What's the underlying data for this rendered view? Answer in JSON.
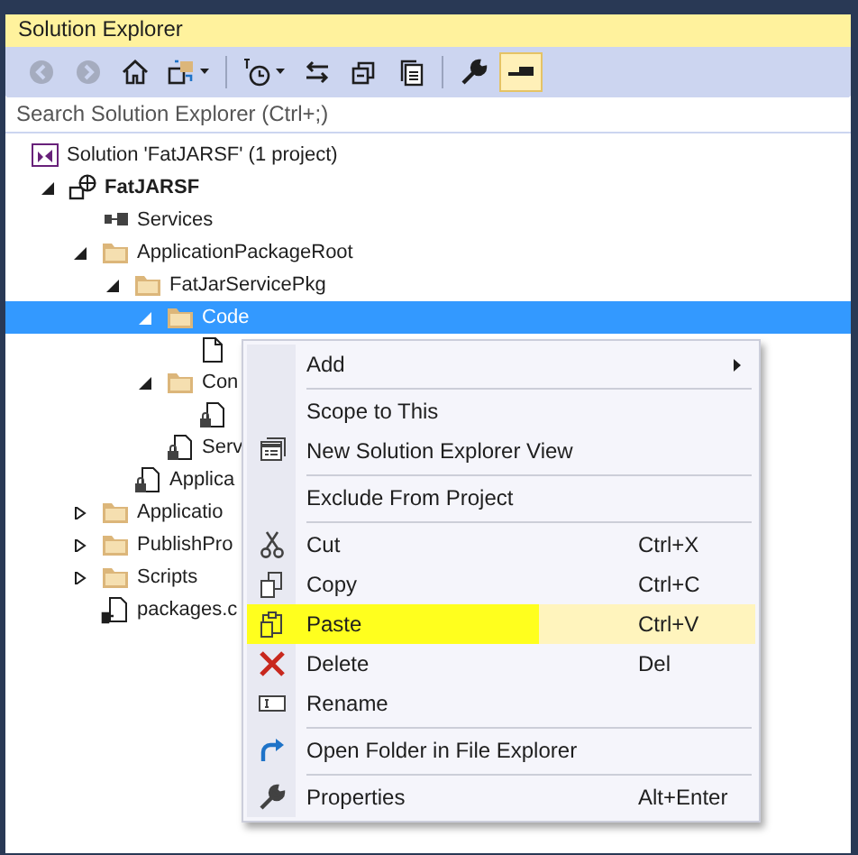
{
  "window": {
    "title": "Solution Explorer"
  },
  "toolbar": [
    {
      "kind": "back",
      "disabled": true,
      "pressed": false,
      "dropdown": false
    },
    {
      "kind": "forward",
      "disabled": true,
      "pressed": false,
      "dropdown": false
    },
    {
      "kind": "home",
      "disabled": false,
      "pressed": false,
      "dropdown": false
    },
    {
      "kind": "switch-views",
      "disabled": false,
      "pressed": false,
      "dropdown": true
    },
    {
      "kind": "separator"
    },
    {
      "kind": "pending-changes",
      "disabled": false,
      "pressed": false,
      "dropdown": true
    },
    {
      "kind": "sync",
      "disabled": false,
      "pressed": false,
      "dropdown": false
    },
    {
      "kind": "collapse",
      "disabled": false,
      "pressed": false,
      "dropdown": false
    },
    {
      "kind": "show-all",
      "disabled": false,
      "pressed": false,
      "dropdown": false
    },
    {
      "kind": "separator"
    },
    {
      "kind": "properties",
      "disabled": false,
      "pressed": false,
      "dropdown": false
    },
    {
      "kind": "preview",
      "disabled": false,
      "pressed": true,
      "dropdown": false
    }
  ],
  "search": {
    "placeholder": "Search Solution Explorer (Ctrl+;)"
  },
  "tree": [
    {
      "label": "Solution 'FatJARSF' (1 project)",
      "kind": "solution",
      "selected": false,
      "children": [
        {
          "label": "FatJARSF",
          "kind": "project",
          "expanded": true,
          "selected": false,
          "children": [
            {
              "label": "Services",
              "kind": "services",
              "selected": false
            },
            {
              "label": "ApplicationPackageRoot",
              "kind": "folder",
              "expanded": true,
              "selected": false,
              "children": [
                {
                  "label": "FatJarServicePkg",
                  "kind": "folder",
                  "expanded": true,
                  "selected": false,
                  "children": [
                    {
                      "label": "Code",
                      "kind": "folder",
                      "expanded": true,
                      "selected": true,
                      "children": [
                        {
                          "kind": "file",
                          "selected": false
                        }
                      ]
                    },
                    {
                      "label": "Con",
                      "kind": "folder",
                      "expanded": true,
                      "selected": false,
                      "children": [
                        {
                          "kind": "manifest",
                          "selected": false
                        }
                      ]
                    },
                    {
                      "label": "Serv",
                      "kind": "manifest",
                      "selected": false
                    }
                  ]
                },
                {
                  "label": "Applica",
                  "kind": "manifest",
                  "selected": false
                }
              ]
            },
            {
              "label": "Applicatio",
              "kind": "folder",
              "expanded": false,
              "selected": false
            },
            {
              "label": "PublishPro",
              "kind": "folder",
              "expanded": false,
              "selected": false
            },
            {
              "label": "Scripts",
              "kind": "folder",
              "expanded": false,
              "selected": false
            },
            {
              "label": "packages.c",
              "kind": "config",
              "selected": false
            }
          ]
        }
      ]
    }
  ],
  "context_menu": {
    "items": [
      {
        "kind": "add",
        "label": "Add",
        "submenu": true,
        "selected": false,
        "highlighted": false
      },
      {
        "kind": "separator"
      },
      {
        "kind": "scope",
        "label": "Scope to This",
        "submenu": false,
        "selected": false,
        "highlighted": false
      },
      {
        "kind": "new-view",
        "label": "New Solution Explorer View",
        "submenu": false,
        "selected": false,
        "highlighted": false
      },
      {
        "kind": "separator"
      },
      {
        "kind": "exclude",
        "label": "Exclude From Project",
        "submenu": false,
        "selected": false,
        "highlighted": false
      },
      {
        "kind": "separator"
      },
      {
        "kind": "cut",
        "label": "Cut",
        "shortcut": "Ctrl+X",
        "submenu": false,
        "selected": false,
        "highlighted": false
      },
      {
        "kind": "copy",
        "label": "Copy",
        "shortcut": "Ctrl+C",
        "submenu": false,
        "selected": false,
        "highlighted": false
      },
      {
        "kind": "paste",
        "label": "Paste",
        "shortcut": "Ctrl+V",
        "submenu": false,
        "selected": true,
        "highlighted": true
      },
      {
        "kind": "delete",
        "label": "Delete",
        "shortcut": "Del",
        "submenu": false,
        "selected": false,
        "highlighted": false
      },
      {
        "kind": "rename",
        "label": "Rename",
        "submenu": false,
        "selected": false,
        "highlighted": false
      },
      {
        "kind": "separator"
      },
      {
        "kind": "open-folder",
        "label": "Open Folder in File Explorer",
        "submenu": false,
        "selected": false,
        "highlighted": false
      },
      {
        "kind": "separator"
      },
      {
        "kind": "properties",
        "label": "Properties",
        "shortcut": "Alt+Enter",
        "submenu": false,
        "selected": false,
        "highlighted": false
      }
    ]
  }
}
